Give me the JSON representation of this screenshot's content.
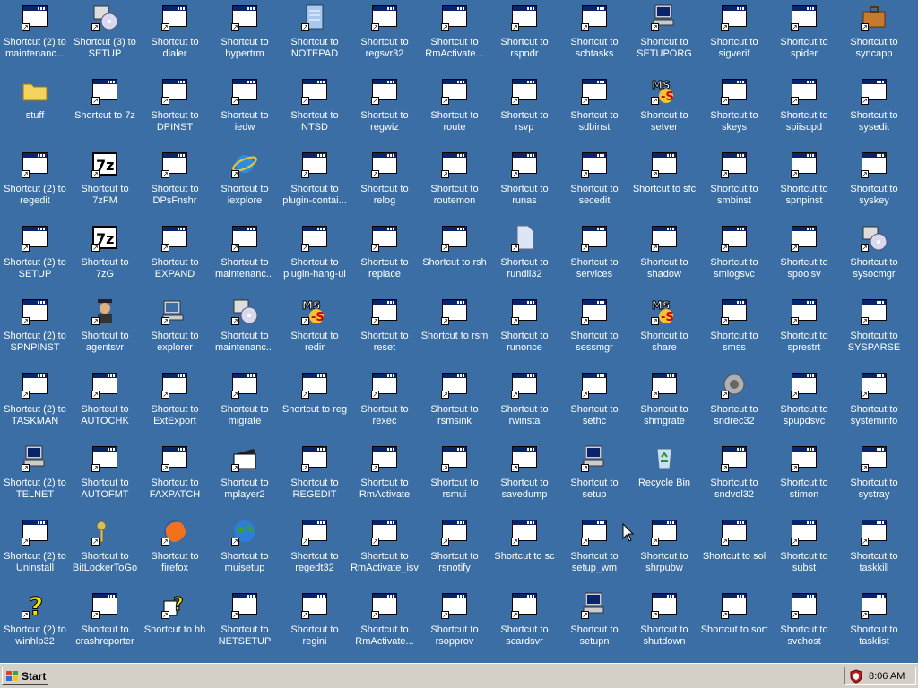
{
  "colors": {
    "desktop": "#3a6ea5",
    "taskbar": "#d4d0c8",
    "label_text": "#ffffff"
  },
  "desktop": {
    "icons": [
      {
        "label": "Shortcut (2) to maintenanc...",
        "icon": "maintenance-setup-icon"
      },
      {
        "label": "stuff",
        "icon": "folder-icon"
      },
      {
        "label": "Shortcut (2) to regedit",
        "icon": "regedit-icon"
      },
      {
        "label": "Shortcut (2) to SETUP",
        "icon": "setup-icon"
      },
      {
        "label": "Shortcut (2) to SPNPINST",
        "icon": "window-icon"
      },
      {
        "label": "Shortcut (2) to TASKMAN",
        "icon": "window-icon"
      },
      {
        "label": "Shortcut (2) to TELNET",
        "icon": "network-computer-icon"
      },
      {
        "label": "Shortcut (2) to Uninstall",
        "icon": "uninstall-icon"
      },
      {
        "label": "Shortcut (2) to winhlp32",
        "icon": "help-icon"
      },
      {
        "label": "Shortcut (3) to SETUP",
        "icon": "setup-disc-icon"
      },
      {
        "label": "Shortcut to 7z",
        "icon": "window-icon"
      },
      {
        "label": "Shortcut to 7zFM",
        "icon": "7zip-icon"
      },
      {
        "label": "Shortcut to 7zG",
        "icon": "7zip-icon"
      },
      {
        "label": "Shortcut to agentsvr",
        "icon": "agent-icon"
      },
      {
        "label": "Shortcut to AUTOCHK",
        "icon": "window-icon"
      },
      {
        "label": "Shortcut to AUTOFMT",
        "icon": "window-icon"
      },
      {
        "label": "Shortcut to BitLockerToGo",
        "icon": "keys-icon"
      },
      {
        "label": "Shortcut to crashreporter",
        "icon": "crashreporter-icon"
      },
      {
        "label": "Shortcut to dialer",
        "icon": "dialer-icon"
      },
      {
        "label": "Shortcut to DPINST",
        "icon": "books-icon"
      },
      {
        "label": "Shortcut to DPsFnshr",
        "icon": "dpsfnshr-icon"
      },
      {
        "label": "Shortcut to EXPAND",
        "icon": "window-icon"
      },
      {
        "label": "Shortcut to explorer",
        "icon": "computer-icon"
      },
      {
        "label": "Shortcut to ExtExport",
        "icon": "window-icon"
      },
      {
        "label": "Shortcut to FAXPATCH",
        "icon": "window-icon"
      },
      {
        "label": "Shortcut to firefox",
        "icon": "firefox-icon"
      },
      {
        "label": "Shortcut to hh",
        "icon": "help-file-icon"
      },
      {
        "label": "Shortcut to hypertrm",
        "icon": "hypertrm-icon"
      },
      {
        "label": "Shortcut to iedw",
        "icon": "window-icon"
      },
      {
        "label": "Shortcut to iexplore",
        "icon": "internet-explorer-icon"
      },
      {
        "label": "Shortcut to maintenanc...",
        "icon": "window-icon"
      },
      {
        "label": "Shortcut to maintenanc...",
        "icon": "setup-disc-icon"
      },
      {
        "label": "Shortcut to migrate",
        "icon": "window-icon"
      },
      {
        "label": "Shortcut to mplayer2",
        "icon": "clapper-icon"
      },
      {
        "label": "Shortcut to muisetup",
        "icon": "globe-icon"
      },
      {
        "label": "Shortcut to NETSETUP",
        "icon": "netsetup-icon"
      },
      {
        "label": "Shortcut to NOTEPAD",
        "icon": "notepad-icon"
      },
      {
        "label": "Shortcut to NTSD",
        "icon": "ntsd-icon"
      },
      {
        "label": "Shortcut to plugin-contai...",
        "icon": "window-icon"
      },
      {
        "label": "Shortcut to plugin-hang-ui",
        "icon": "window-icon"
      },
      {
        "label": "Shortcut to redir",
        "icon": "ms-dos-icon"
      },
      {
        "label": "Shortcut to reg",
        "icon": "window-icon"
      },
      {
        "label": "Shortcut to REGEDIT",
        "icon": "regedit-icon"
      },
      {
        "label": "Shortcut to regedt32",
        "icon": "regedt32-icon"
      },
      {
        "label": "Shortcut to regini",
        "icon": "window-icon"
      },
      {
        "label": "Shortcut to regsvr32",
        "icon": "window-icon"
      },
      {
        "label": "Shortcut to regwiz",
        "icon": "window-icon"
      },
      {
        "label": "Shortcut to relog",
        "icon": "window-icon"
      },
      {
        "label": "Shortcut to replace",
        "icon": "window-icon"
      },
      {
        "label": "Shortcut to reset",
        "icon": "window-icon"
      },
      {
        "label": "Shortcut to rexec",
        "icon": "window-icon"
      },
      {
        "label": "Shortcut to RmActivate",
        "icon": "window-icon"
      },
      {
        "label": "Shortcut to RmActivate_isv",
        "icon": "window-icon"
      },
      {
        "label": "Shortcut to RmActivate...",
        "icon": "window-icon"
      },
      {
        "label": "Shortcut to RmActivate...",
        "icon": "window-icon"
      },
      {
        "label": "Shortcut to route",
        "icon": "window-icon"
      },
      {
        "label": "Shortcut to routemon",
        "icon": "window-icon"
      },
      {
        "label": "Shortcut to rsh",
        "icon": "window-icon"
      },
      {
        "label": "Shortcut to rsm",
        "icon": "window-icon"
      },
      {
        "label": "Shortcut to rsmsink",
        "icon": "window-icon"
      },
      {
        "label": "Shortcut to rsmui",
        "icon": "rsmui-icon"
      },
      {
        "label": "Shortcut to rsnotify",
        "icon": "rsnotify-icon"
      },
      {
        "label": "Shortcut to rsopprov",
        "icon": "window-icon"
      },
      {
        "label": "Shortcut to rspndr",
        "icon": "window-icon"
      },
      {
        "label": "Shortcut to rsvp",
        "icon": "window-icon"
      },
      {
        "label": "Shortcut to runas",
        "icon": "window-icon"
      },
      {
        "label": "Shortcut to rundll32",
        "icon": "document-icon"
      },
      {
        "label": "Shortcut to runonce",
        "icon": "runonce-icon"
      },
      {
        "label": "Shortcut to rwinsta",
        "icon": "window-icon"
      },
      {
        "label": "Shortcut to savedump",
        "icon": "window-icon"
      },
      {
        "label": "Shortcut to sc",
        "icon": "window-icon"
      },
      {
        "label": "Shortcut to scardsvr",
        "icon": "window-icon"
      },
      {
        "label": "Shortcut to schtasks",
        "icon": "window-icon"
      },
      {
        "label": "Shortcut to sdbinst",
        "icon": "window-icon"
      },
      {
        "label": "Shortcut to secedit",
        "icon": "window-icon"
      },
      {
        "label": "Shortcut to services",
        "icon": "window-icon"
      },
      {
        "label": "Shortcut to sessmgr",
        "icon": "window-icon"
      },
      {
        "label": "Shortcut to sethc",
        "icon": "window-icon"
      },
      {
        "label": "Shortcut to setup",
        "icon": "network-computer-icon"
      },
      {
        "label": "Shortcut to setup_wm",
        "icon": "media-player-icon"
      },
      {
        "label": "Shortcut to setupn",
        "icon": "network-computer-icon"
      },
      {
        "label": "Shortcut to SETUPORG",
        "icon": "network-computer-icon"
      },
      {
        "label": "Shortcut to setver",
        "icon": "ms-dos-icon"
      },
      {
        "label": "Shortcut to sfc",
        "icon": "window-icon"
      },
      {
        "label": "Shortcut to shadow",
        "icon": "window-icon"
      },
      {
        "label": "Shortcut to share",
        "icon": "ms-dos-icon"
      },
      {
        "label": "Shortcut to shmgrate",
        "icon": "window-icon"
      },
      {
        "label": "Recycle Bin",
        "icon": "recycle-bin-icon"
      },
      {
        "label": "Shortcut to shrpubw",
        "icon": "shared-folder-icon"
      },
      {
        "label": "Shortcut to shutdown",
        "icon": "window-icon"
      },
      {
        "label": "Shortcut to sigverif",
        "icon": "sigverif-icon"
      },
      {
        "label": "Shortcut to skeys",
        "icon": "window-icon"
      },
      {
        "label": "Shortcut to smbinst",
        "icon": "window-icon"
      },
      {
        "label": "Shortcut to smlogsvc",
        "icon": "window-icon"
      },
      {
        "label": "Shortcut to smss",
        "icon": "window-icon"
      },
      {
        "label": "Shortcut to sndrec32",
        "icon": "speaker-icon"
      },
      {
        "label": "Shortcut to sndvol32",
        "icon": "sndvol-icon"
      },
      {
        "label": "Shortcut to sol",
        "icon": "solitaire-icon"
      },
      {
        "label": "Shortcut to sort",
        "icon": "window-icon"
      },
      {
        "label": "Shortcut to spider",
        "icon": "spider-icon"
      },
      {
        "label": "Shortcut to spiisupd",
        "icon": "window-icon"
      },
      {
        "label": "Shortcut to spnpinst",
        "icon": "window-icon"
      },
      {
        "label": "Shortcut to spoolsv",
        "icon": "window-icon"
      },
      {
        "label": "Shortcut to sprestrt",
        "icon": "window-icon"
      },
      {
        "label": "Shortcut to spupdsvc",
        "icon": "window-icon"
      },
      {
        "label": "Shortcut to stimon",
        "icon": "stimon-icon"
      },
      {
        "label": "Shortcut to subst",
        "icon": "window-icon"
      },
      {
        "label": "Shortcut to svchost",
        "icon": "window-icon"
      },
      {
        "label": "Shortcut to syncapp",
        "icon": "briefcase-icon"
      },
      {
        "label": "Shortcut to sysedit",
        "icon": "sysedit-icon"
      },
      {
        "label": "Shortcut to syskey",
        "icon": "syskey-icon"
      },
      {
        "label": "Shortcut to sysocmgr",
        "icon": "setup-disc-icon"
      },
      {
        "label": "Shortcut to SYSPARSE",
        "icon": "window-icon"
      },
      {
        "label": "Shortcut to systeminfo",
        "icon": "window-icon"
      },
      {
        "label": "Shortcut to systray",
        "icon": "window-icon"
      },
      {
        "label": "Shortcut to taskkill",
        "icon": "window-icon"
      },
      {
        "label": "Shortcut to tasklist",
        "icon": "window-icon"
      }
    ]
  },
  "taskbar": {
    "start_label": "Start",
    "clock": "8:06 AM",
    "tray_icon": "security-shield-icon"
  }
}
